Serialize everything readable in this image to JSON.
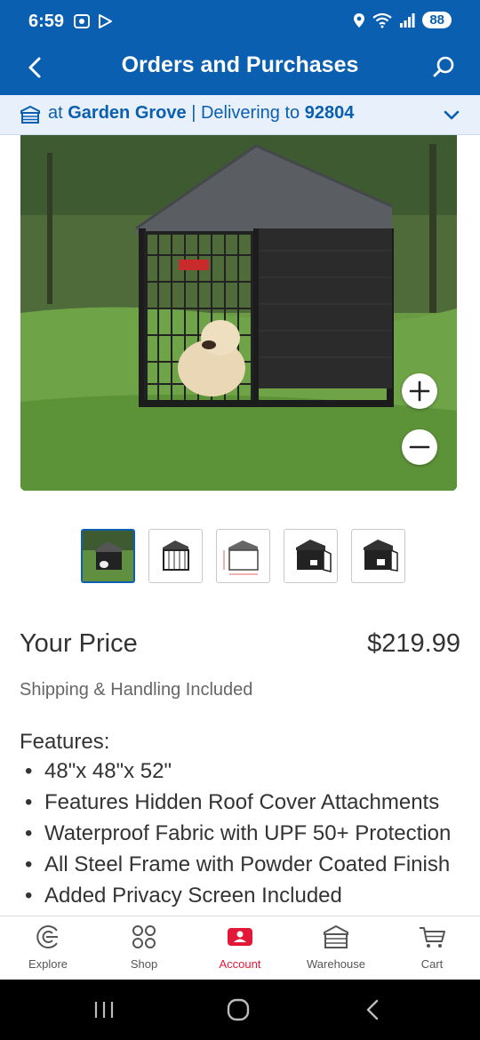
{
  "status_bar": {
    "time": "6:59",
    "battery": "88"
  },
  "header": {
    "title": "Orders and Purchases"
  },
  "location": {
    "prefix": "at",
    "store": "Garden Grove",
    "separator": "|",
    "delivering": "Delivering to",
    "zip": "92804"
  },
  "product": {
    "price_label": "Your Price",
    "price": "$219.99",
    "shipping": "Shipping & Handling Included",
    "features_title": "Features:",
    "features": [
      "48\"x 48\"x 52\"",
      "Features Hidden Roof Cover Attachments",
      "Waterproof Fabric with UPF 50+ Protection",
      "All Steel Frame with Powder Coated Finish",
      "Added Privacy Screen Included"
    ],
    "thumbnail_count": 5,
    "selected_thumbnail": 1
  },
  "bottom_nav": [
    {
      "label": "Explore",
      "icon": "explore-icon",
      "active": false
    },
    {
      "label": "Shop",
      "icon": "shop-grid-icon",
      "active": false
    },
    {
      "label": "Account",
      "icon": "account-icon",
      "active": true
    },
    {
      "label": "Warehouse",
      "icon": "warehouse-icon",
      "active": false
    },
    {
      "label": "Cart",
      "icon": "cart-icon",
      "active": false
    }
  ],
  "colors": {
    "brand_blue": "#0a5fb1",
    "accent_red": "#e31837",
    "location_bg": "#e8f1fb"
  }
}
